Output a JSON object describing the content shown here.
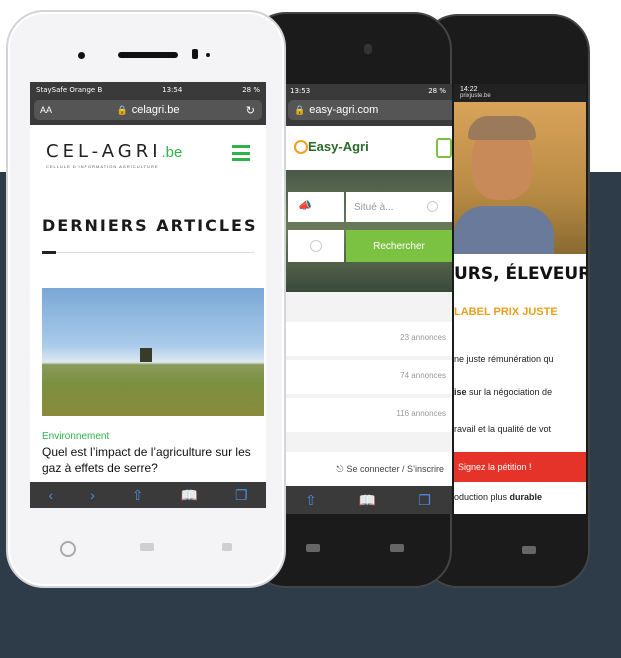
{
  "phone1": {
    "carrier": "StaySafe Orange B",
    "time": "13:54",
    "battery": "28 %",
    "url_left": "AA",
    "url": "celagri.be",
    "logo_main": "CEL-AGRI",
    "logo_suffix": ".be",
    "logo_tagline": "CELLULE D'INFORMATION AGRICULTURE",
    "section_title": "DERNIERS ARTICLES",
    "article_category": "Environnement",
    "article_title": "Quel est l’impact de l’agriculture sur les gaz à effets de serre?",
    "accent_color": "#2db34a"
  },
  "phone2": {
    "time": "13:53",
    "battery": "28 %",
    "url": "easy-agri.com",
    "logo": "Easy-Agri",
    "location_placeholder": "Situé à...",
    "search_button": "Rechercher",
    "rows": [
      {
        "count": "23 annonces"
      },
      {
        "count": "74 annonces"
      },
      {
        "count": "116 annonces"
      }
    ],
    "login_link": "Se connecter / S’inscrire",
    "accent_color": "#7cc242"
  },
  "phone3": {
    "time": "14:22",
    "url": "prixjuste.be",
    "heading": "URS, ÉLEVEURS",
    "label": "LABEL PRIX JUSTE",
    "line1": "ne juste rémunération qu",
    "line2_bold": "ise",
    "line2_rest": " sur la négociation de",
    "line3": "ravail et la qualité de vot",
    "petition_button": "Signez la pétition !",
    "line4_pre": "oduction plus ",
    "line4_bold": "durable",
    "accent_color": "#e8a020",
    "petition_color": "#e5332a"
  }
}
